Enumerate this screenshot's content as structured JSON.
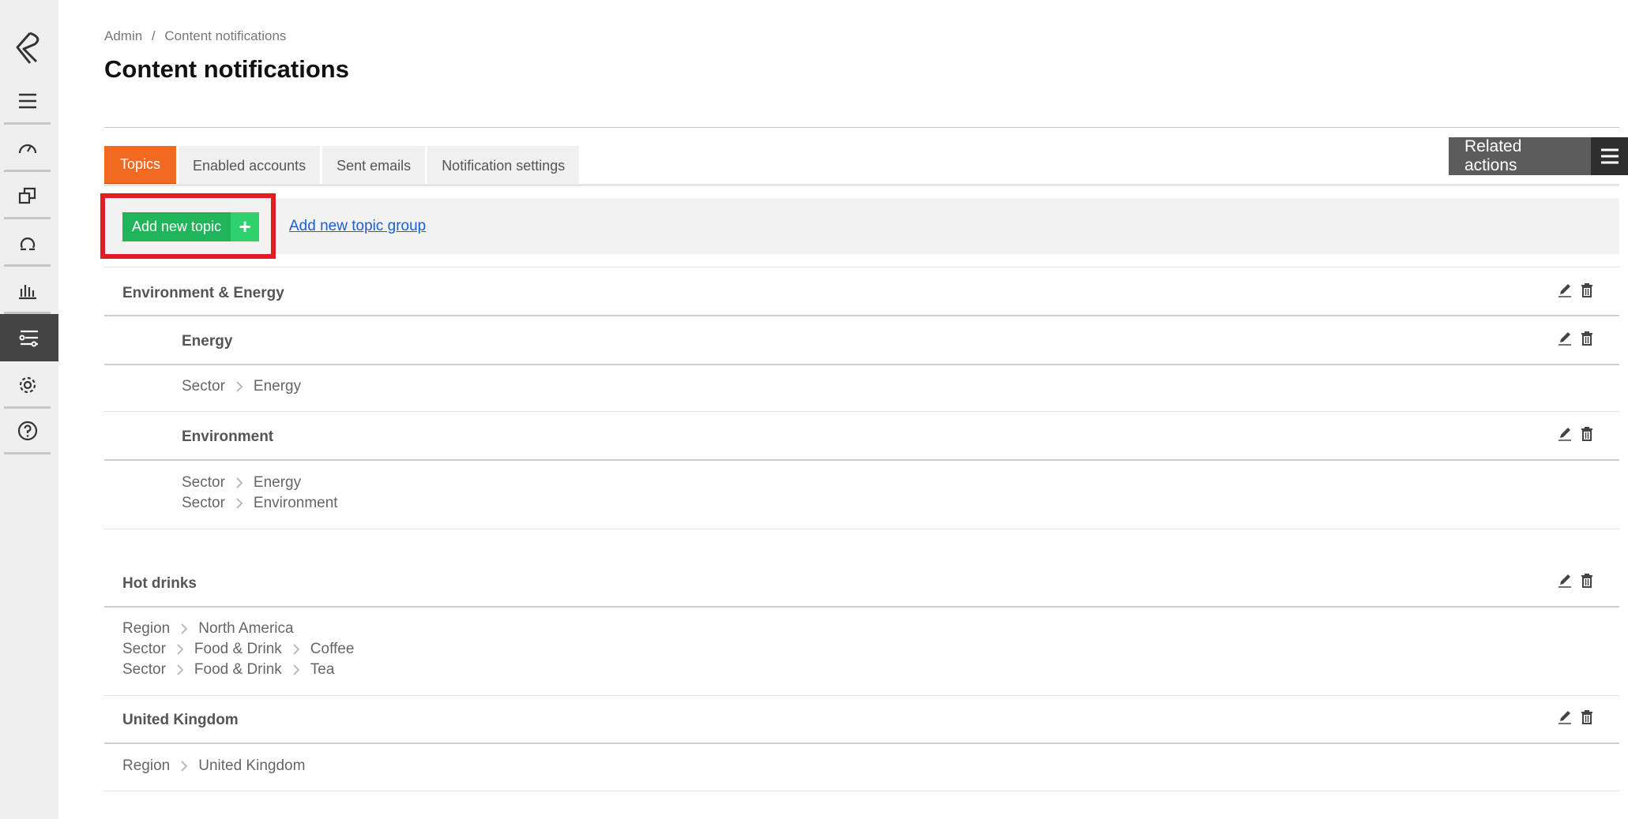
{
  "breadcrumb": {
    "root": "Admin",
    "separator": "/",
    "current": "Content notifications"
  },
  "page": {
    "title": "Content notifications"
  },
  "tabs": [
    {
      "label": "Topics",
      "active": true
    },
    {
      "label": "Enabled accounts",
      "active": false
    },
    {
      "label": "Sent emails",
      "active": false
    },
    {
      "label": "Notification settings",
      "active": false
    }
  ],
  "related_actions": {
    "label": "Related actions"
  },
  "toolbar": {
    "add_topic_label": "Add new topic",
    "add_topic_plus": "+",
    "add_group_label": "Add new topic group"
  },
  "topics": {
    "group_env": {
      "title": "Environment & Energy",
      "energy": {
        "title": "Energy",
        "path1": [
          "Sector",
          "Energy"
        ]
      },
      "environment": {
        "title": "Environment",
        "path1": [
          "Sector",
          "Energy"
        ],
        "path2": [
          "Sector",
          "Environment"
        ]
      }
    },
    "hot_drinks": {
      "title": "Hot drinks",
      "path1": [
        "Region",
        "North America"
      ],
      "path2": [
        "Sector",
        "Food & Drink",
        "Coffee"
      ],
      "path3": [
        "Sector",
        "Food & Drink",
        "Tea"
      ]
    },
    "uk": {
      "title": "United Kingdom",
      "path1": [
        "Region",
        "United Kingdom"
      ]
    }
  },
  "colors": {
    "accent": "#f26a21",
    "add_button": "#20b55a",
    "highlight": "#e01c24",
    "link": "#1a5fd6"
  }
}
